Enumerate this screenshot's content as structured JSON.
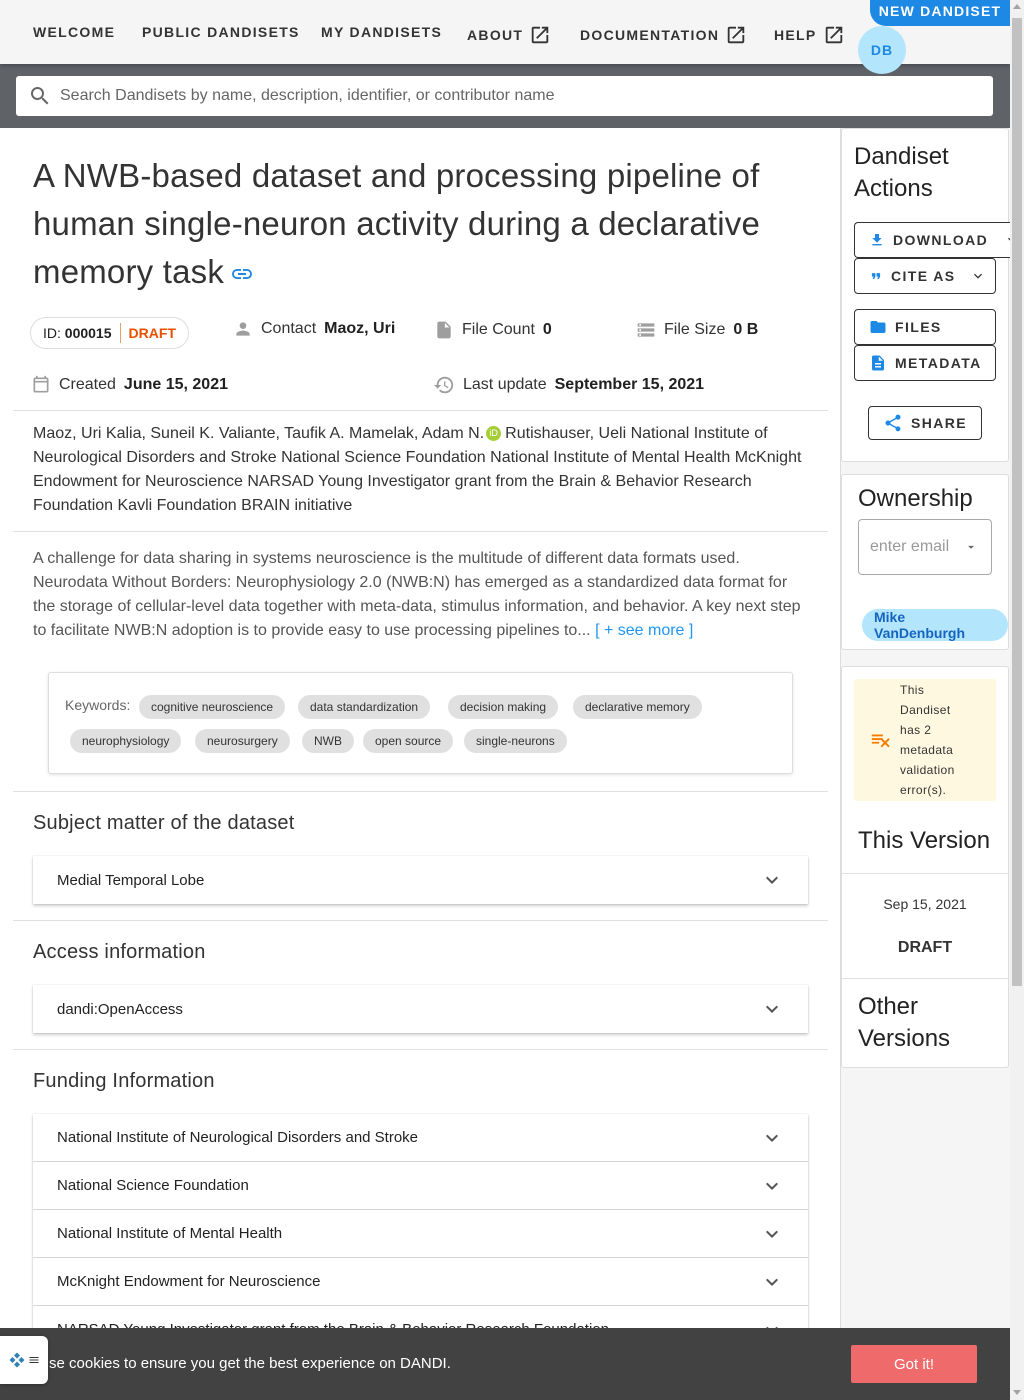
{
  "nav": {
    "welcome": "WELCOME",
    "public": "PUBLIC DANDISETS",
    "my": "MY DANDISETS",
    "about": "ABOUT",
    "docs": "DOCUMENTATION",
    "help": "HELP",
    "new_dandiset": "NEW DANDISET",
    "avatar_initials": "DB"
  },
  "search": {
    "placeholder": "Search Dandisets by name, description, identifier, or contributor name"
  },
  "dandiset": {
    "title": "A NWB-based dataset and processing pipeline of human single-neuron activity during a declarative memory task",
    "id_label": "ID:",
    "id": "000015",
    "status": "DRAFT",
    "contact_label": "Contact",
    "contact": "Maoz, Uri",
    "file_count_label": "File Count",
    "file_count": "0",
    "file_size_label": "File Size",
    "file_size": "0 B",
    "created_label": "Created",
    "created": "June 15, 2021",
    "updated_label": "Last update",
    "updated": "September 15, 2021",
    "contributors_before_orcid": "Maoz, Uri Kalia, Suneil K. Valiante, Taufik A. Mamelak, Adam N.",
    "contributors_after_orcid": "Rutishauser, Ueli National Institute of Neurological Disorders and Stroke National Science Foundation National Institute of Mental Health McKnight Endowment for Neuroscience NARSAD Young Investigator grant from the Brain & Behavior Research Foundation Kavli Foundation BRAIN initiative",
    "orcid_glyph": "iD",
    "description": "A challenge for data sharing in systems neuroscience is the multitude of different data formats used. Neurodata Without Borders: Neurophysiology 2.0 (NWB:N) has emerged as a standardized data format for the storage of cellular-level data together with meta-data, stimulus information, and behavior. A key next step to facilitate NWB:N adoption is to provide easy to use processing pipelines to...",
    "see_more": "[ + see more ]",
    "keywords_label": "Keywords:",
    "keywords": [
      "cognitive neuroscience",
      "data standardization",
      "decision making",
      "declarative memory",
      "neurophysiology",
      "neurosurgery",
      "NWB",
      "open source",
      "single-neurons"
    ]
  },
  "sections": {
    "subject_title": "Subject matter of the dataset",
    "subject_items": [
      "Medial Temporal Lobe"
    ],
    "access_title": "Access information",
    "access_items": [
      "dandi:OpenAccess"
    ],
    "funding_title": "Funding Information",
    "funding_items": [
      "National Institute of Neurological Disorders and Stroke",
      "National Science Foundation",
      "National Institute of Mental Health",
      "McKnight Endowment for Neuroscience",
      "NARSAD Young Investigator grant from the Brain & Behavior Research Foundation"
    ]
  },
  "sidebar": {
    "actions_title": "Dandiset Actions",
    "download": "DOWNLOAD",
    "cite": "CITE AS",
    "files": "FILES",
    "metadata": "METADATA",
    "share": "SHARE",
    "ownership_title": "Ownership",
    "owner_placeholder": "enter email",
    "owner": "Mike VanDenburgh",
    "validation_warning": "This Dandiset has 2 metadata validation error(s).",
    "this_version_title": "This Version",
    "version_date": "Sep 15, 2021",
    "version_name": "DRAFT",
    "other_versions_title": "Other Versions"
  },
  "cookie": {
    "text": "se cookies to ensure you get the best experience on DANDI.",
    "button": "Got it!"
  },
  "colors": {
    "accent": "#1e88e5",
    "draft": "#e65100",
    "cookie_button": "#ef6b6b",
    "warning_bg": "#fff8e1"
  }
}
